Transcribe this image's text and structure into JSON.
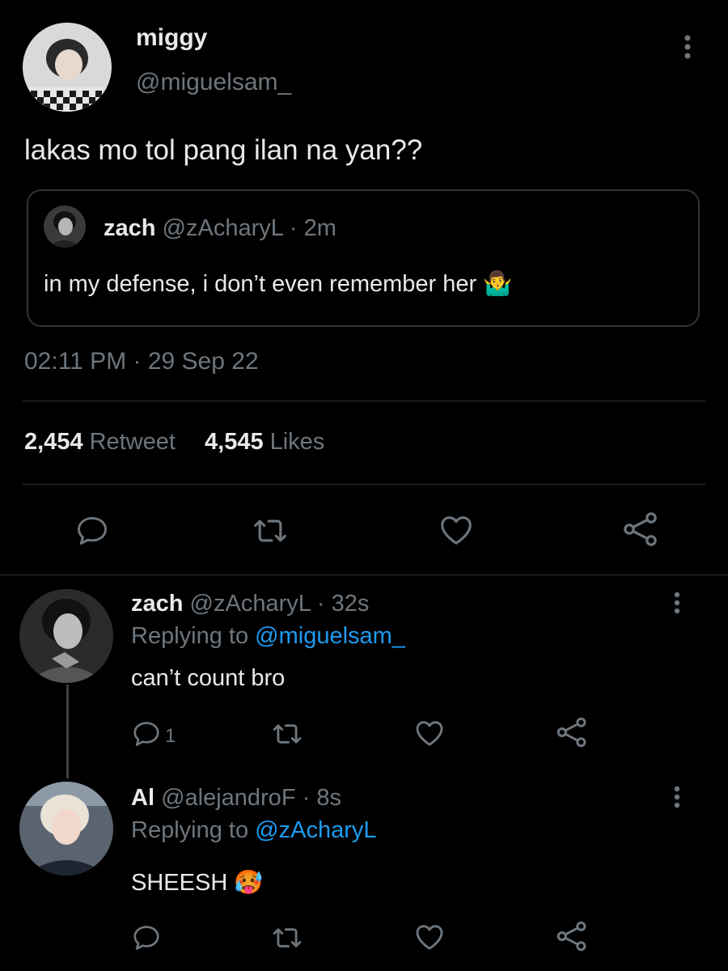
{
  "main_tweet": {
    "name": "miggy",
    "handle": "@miguelsam_",
    "text": "lakas mo tol pang ilan na yan??",
    "quote": {
      "name": "zach",
      "handle": "@zAcharyL",
      "sep": "·",
      "time": "2m",
      "text": "in my defense, i don’t even remember her 🤷‍♂️"
    },
    "timestamp": "02:11 PM · 29 Sep 22",
    "stats": {
      "retweets": "2,454",
      "retweets_label": "Retweet",
      "likes": "4,545",
      "likes_label": "Likes"
    }
  },
  "replies": [
    {
      "name": "zach",
      "handle": "@zAcharyL",
      "sep": "·",
      "time": "32s",
      "replying_label": "Replying to",
      "replying_to": "@miguelsam_",
      "text": "can’t count bro",
      "reply_count": "1"
    },
    {
      "name": "Al",
      "handle": "@alejandroF",
      "sep": "·",
      "time": "8s",
      "replying_label": "Replying to",
      "replying_to": "@zAcharyL",
      "text": "SHEESH 🥵"
    }
  ],
  "colors": {
    "background": "#000000",
    "text": "#e7e9ea",
    "muted": "#6e767d",
    "link": "#1d9bf0",
    "border": "#2f3336"
  },
  "icons": [
    "more-vertical-icon",
    "reply-icon",
    "retweet-icon",
    "like-icon",
    "share-icon"
  ]
}
